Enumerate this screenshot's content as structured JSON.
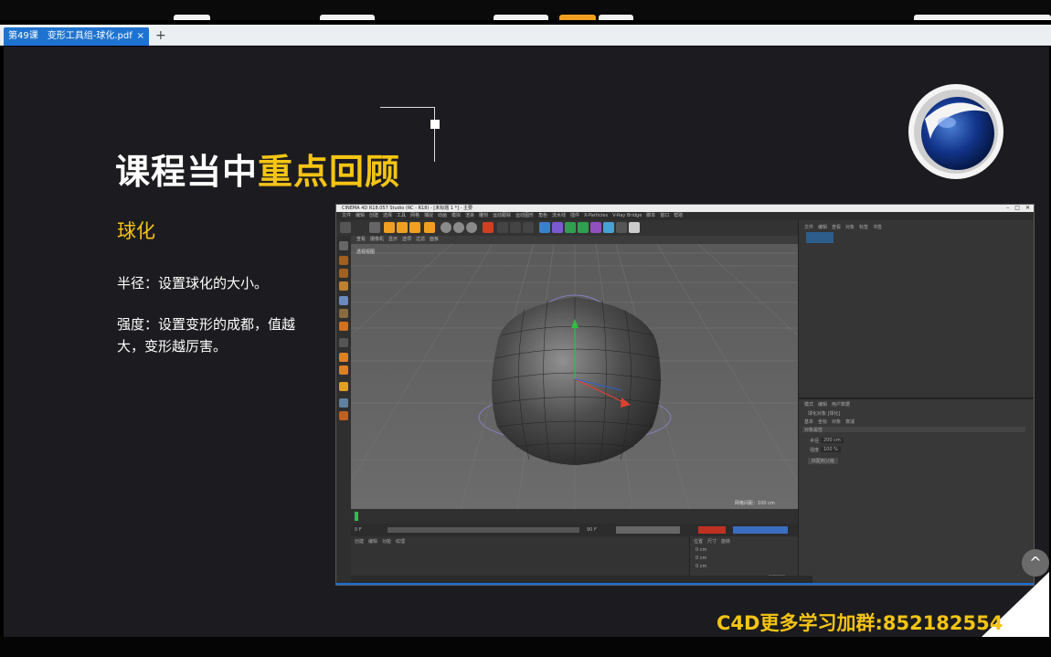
{
  "browser": {
    "tab_label": "第49课　变形工具组-球化.pdf",
    "tab_close": "×",
    "new_tab": "+"
  },
  "slide": {
    "title_main": "课程当中",
    "title_highlight": "重点回顾",
    "subtitle": "球化",
    "para1": "半径：设置球化的大小。",
    "para2": "强度：设置变形的成都，值越大，变形越厉害。",
    "footer": "C4D更多学习加群:852182554",
    "scroll_up_glyph": "^"
  },
  "c4d": {
    "window_title": "CINEMA 4D R18.057 Studio (RC - R18) - [未标题 1 *] - 主要",
    "menu": "文件　编辑　创建　选择　工具　网格　捕捉　动画　模拟　渲染　雕刻　运动跟踪　运动图形　角色　流水线　插件　X-Particles　V-Ray Bridge　脚本　窗口　帮助",
    "viewport_menu": "查看　摄像机　显示　选项　过滤　面板",
    "viewport_label": "透视视图",
    "grid_label": "网格间距：100 cm",
    "obj_menu": "文件　编辑　查看　对象　标签　书签",
    "attr_menu": "模式　编辑　用户数据",
    "attr_object": "球化对象 [球化]",
    "attr_tabs": "基本　坐标　对象　衰减",
    "attr_section": "对象属性",
    "radius_label": "半径",
    "radius_value": "200 cm",
    "strength_label": "强度",
    "strength_value": "100 %",
    "fit_button": "匹配到父级",
    "mat_menu": "创建　编辑　功能　纹理",
    "coord_headers": "位置　尺寸　旋转",
    "coord_x": "0 cm",
    "coord_y": "0 cm",
    "coord_z": "0 cm",
    "apply_button": "应用",
    "frame_start": "0 F",
    "frame_end": "90 F"
  },
  "colors": {
    "accent_yellow": "#f5c414",
    "slide_bg": "#1c1c20",
    "tab_blue": "#1f73d0"
  }
}
